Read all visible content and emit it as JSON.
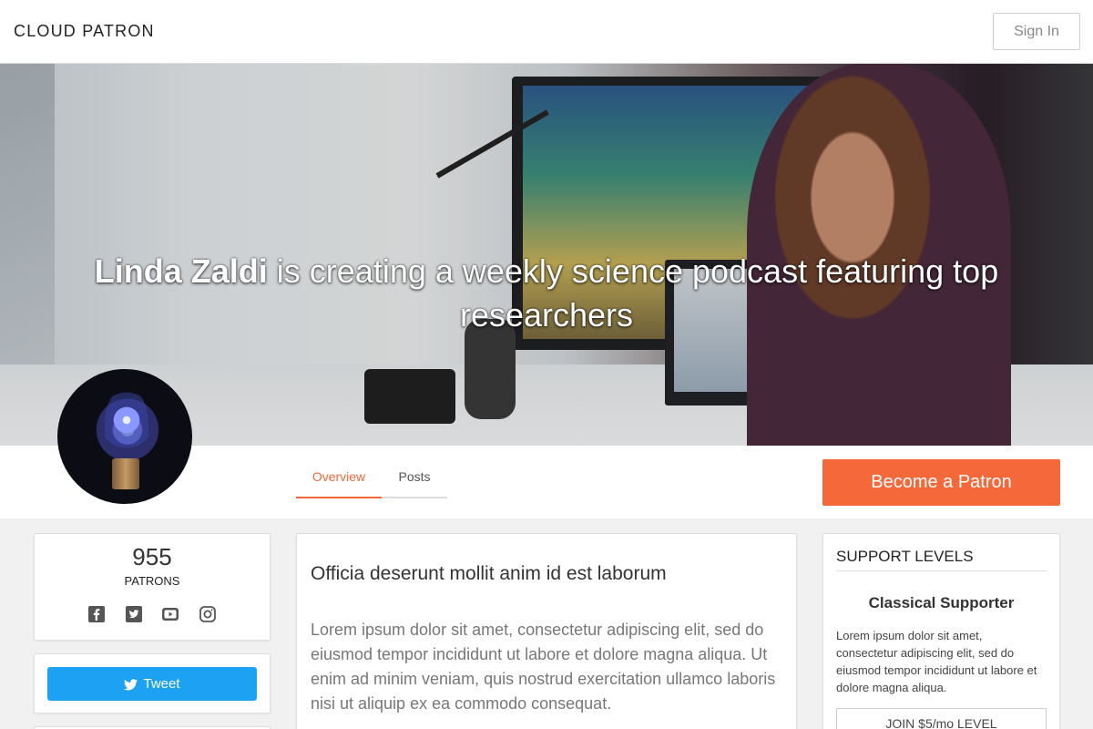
{
  "header": {
    "brand": "CLOUD PATRON",
    "signin_label": "Sign In"
  },
  "hero": {
    "creator_name": "Linda Zaldi",
    "tagline": " is creating a weekly science podcast featuring top researchers"
  },
  "tabs": [
    {
      "label": "Overview",
      "active": true
    },
    {
      "label": "Posts",
      "active": false
    }
  ],
  "cta": {
    "label": "Become a Patron"
  },
  "stats": {
    "patron_count": "955",
    "patron_label": "PATRONS",
    "socials": [
      "facebook-icon",
      "twitter-icon",
      "youtube-icon",
      "instagram-icon"
    ]
  },
  "tweet": {
    "label": "Tweet"
  },
  "post": {
    "title": "Officia deserunt mollit anim id est laborum",
    "body": "Lorem ipsum dolor sit amet, consectetur adipiscing elit, sed do eiusmod tempor incididunt ut labore et dolore magna aliqua. Ut enim ad minim veniam, quis nostrud exercitation ullamco laboris nisi ut aliquip ex ea commodo consequat."
  },
  "support": {
    "heading": "SUPPORT LEVELS",
    "level_name": "Classical Supporter",
    "level_desc": "Lorem ipsum dolor sit amet, consectetur adipiscing elit, sed do eiusmod tempor incididunt ut labore et dolore magna aliqua.",
    "join_label": "JOIN $5/mo LEVEL"
  },
  "colors": {
    "accent": "#f4683a",
    "tweet": "#1da1f2"
  }
}
